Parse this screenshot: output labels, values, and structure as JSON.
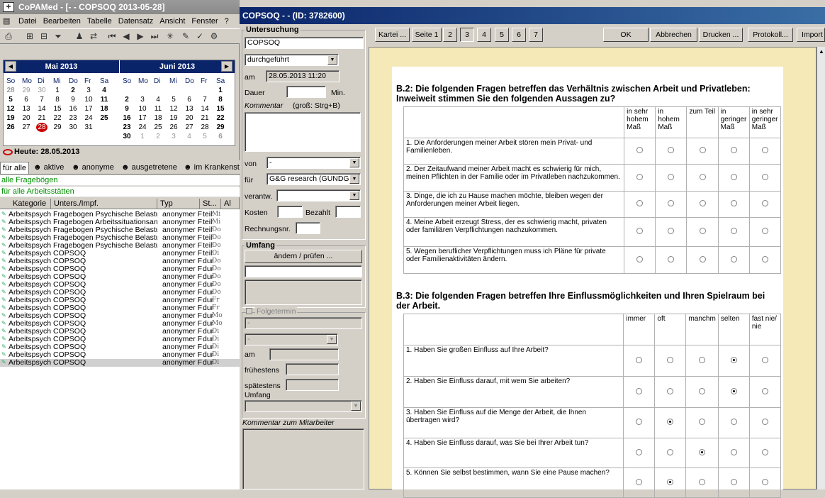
{
  "main_window": {
    "title": "CoPAMed - [- - COPSOQ 2013-05-28]",
    "menu": [
      "Datei",
      "Bearbeiten",
      "Tabelle",
      "Datensatz",
      "Ansicht",
      "Fenster",
      "?"
    ]
  },
  "calendar": {
    "may": {
      "label": "Mai 2013",
      "weekdays": [
        "So",
        "Mo",
        "Di",
        "Mi",
        "Do",
        "Fr",
        "Sa"
      ],
      "rows": [
        [
          "28",
          "29",
          "30",
          "1",
          "2",
          "3",
          "4"
        ],
        [
          "5",
          "6",
          "7",
          "8",
          "9",
          "10",
          "11"
        ],
        [
          "12",
          "13",
          "14",
          "15",
          "16",
          "17",
          "18"
        ],
        [
          "19",
          "20",
          "21",
          "22",
          "23",
          "24",
          "25"
        ],
        [
          "26",
          "27",
          "28",
          "29",
          "30",
          "31",
          ""
        ]
      ]
    },
    "june": {
      "label": "Juni 2013",
      "weekdays": [
        "So",
        "Mo",
        "Di",
        "Mi",
        "Do",
        "Fr",
        "Sa"
      ],
      "rows": [
        [
          "",
          "",
          "",
          "",
          "",
          "",
          "1"
        ],
        [
          "2",
          "3",
          "4",
          "5",
          "6",
          "7",
          "8"
        ],
        [
          "9",
          "10",
          "11",
          "12",
          "13",
          "14",
          "15"
        ],
        [
          "16",
          "17",
          "18",
          "19",
          "20",
          "21",
          "22"
        ],
        [
          "23",
          "24",
          "25",
          "26",
          "27",
          "28",
          "29"
        ],
        [
          "30",
          "1",
          "2",
          "3",
          "4",
          "5",
          "6"
        ]
      ]
    },
    "today_label": "Heute: 28.05.2013"
  },
  "filter_tabs": [
    "für alle",
    "aktive",
    "anonyme",
    "ausgetretene",
    "im Krankenstand"
  ],
  "filter_lines": [
    "alle Fragebögen",
    "für alle Arbeitsstätten"
  ],
  "list": {
    "headers": [
      "Kategorie",
      "Unters./Impf.",
      "Typ",
      "St...",
      "Al"
    ],
    "rows": [
      [
        "Arbeitspsych Fragebogen Psychische Belastung",
        "anonymer FB",
        "teilw.",
        "Mi"
      ],
      [
        "Arbeitspsych Fragebogen Arbeitssituationsanalyse",
        "anonymer FB",
        "teilw.",
        "Mi"
      ],
      [
        "Arbeitspsych Fragebogen Psychische Belastung",
        "anonymer FB",
        "teilw.",
        "Do"
      ],
      [
        "Arbeitspsych Fragebogen Psychische Belastung",
        "anonymer FB",
        "teilw.",
        "Do"
      ],
      [
        "Arbeitspsych Fragebogen Psychische Belastung",
        "anonymer FB",
        "teilw.",
        "Do"
      ],
      [
        "Arbeitspsych COPSOQ",
        "anonymer FB",
        "teilw.",
        "Di"
      ],
      [
        "Arbeitspsych COPSOQ",
        "anonymer FB",
        "durch",
        "Do"
      ],
      [
        "Arbeitspsych COPSOQ",
        "anonymer FB",
        "durch",
        "Do"
      ],
      [
        "Arbeitspsych COPSOQ",
        "anonymer FB",
        "durch",
        "Do"
      ],
      [
        "Arbeitspsych COPSOQ",
        "anonymer FB",
        "durch",
        "Do"
      ],
      [
        "Arbeitspsych COPSOQ",
        "anonymer FB",
        "durch",
        "Do"
      ],
      [
        "Arbeitspsych COPSOQ",
        "anonymer FB",
        "durch",
        "Fr"
      ],
      [
        "Arbeitspsych COPSOQ",
        "anonymer FB",
        "durch",
        "Fr"
      ],
      [
        "Arbeitspsych COPSOQ",
        "anonymer FB",
        "durch",
        "Mo"
      ],
      [
        "Arbeitspsych COPSOQ",
        "anonymer FB",
        "durch",
        "Mo"
      ],
      [
        "Arbeitspsych COPSOQ",
        "anonymer FB",
        "durch",
        "Di"
      ],
      [
        "Arbeitspsych COPSOQ",
        "anonymer FB",
        "durch",
        "Di"
      ],
      [
        "Arbeitspsych COPSOQ",
        "anonymer FB",
        "durch",
        "Di"
      ],
      [
        "Arbeitspsych COPSOQ",
        "anonymer FB",
        "durch",
        "Di"
      ],
      [
        "Arbeitspsych COPSOQ",
        "anonymer FB",
        "durch",
        "Di"
      ]
    ]
  },
  "dialog": {
    "title": "COPSOQ -  - (ID: 3782600)",
    "untersuchung": {
      "group_label": "Untersuchung",
      "name": "COPSOQ",
      "status": "durchgeführt",
      "am_label": "am",
      "am_value": "28.05.2013 11:20",
      "dauer_label": "Dauer",
      "dauer_unit": "Min.",
      "kommentar_label": "Kommentar",
      "kommentar_hint": "(groß: Strg+B)",
      "von_label": "von",
      "von_value": "-",
      "fuer_label": "für",
      "fuer_value": "G&G research (GUNDG",
      "verantw_label": "verantw.",
      "kosten_label": "Kosten",
      "bezahlt_label": "Bezahlt",
      "rechnungsnr_label": "Rechnungsnr."
    },
    "umfang": {
      "group_label": "Umfang",
      "button": "ändern / prüfen ..."
    },
    "folgetermin": {
      "checkbox_label": "Folgetermin",
      "field": "-",
      "select": "-",
      "am_label": "am",
      "fruehestens_label": "frühestens",
      "spaetestens_label": "spätestens",
      "umfang_label": "Umfang"
    },
    "kommentar_mitarbeiter_label": "Kommentar zum Mitarbeiter",
    "page_tabs": [
      "Kartei ...",
      "Seite 1",
      "2",
      "3",
      "4",
      "5",
      "6",
      "7"
    ],
    "active_page": "3",
    "action_buttons": [
      "OK",
      "Abbrechen",
      "Drucken ...",
      "Protokoll...",
      "Import"
    ]
  },
  "questionnaire": {
    "b2": {
      "title": "B.2: Die folgenden Fragen betreffen das Verhältnis zwischen Arbeit und Privatleben: Inweiweit stimmen Sie den folgenden Aussagen zu?",
      "columns": [
        "in sehr hohem Maß",
        "in hohem Maß",
        "zum Teil",
        "in geringer Maß",
        "in sehr geringer Maß"
      ],
      "questions": [
        {
          "text": "1. Die Anforderungen meiner Arbeit stören mein Privat- und Familienleben.",
          "selected": -1
        },
        {
          "text": "2. Der Zeitaufwand meiner Arbeit macht es schwierig für mich, meinen Pflichten in der Familie oder im Privatleben nachzukommen.",
          "selected": -1
        },
        {
          "text": "3. Dinge, die ich zu Hause machen möchte, bleiben wegen der Anforderungen meiner Arbeit liegen.",
          "selected": -1
        },
        {
          "text": "4. Meine Arbeit erzeugt Stress, der es schwierig macht, privaten oder familiären Verpflichtungen nachzukommen.",
          "selected": -1
        },
        {
          "text": "5. Wegen beruflicher Verpflichtungen muss ich Pläne für private oder Familienaktivitäten ändern.",
          "selected": -1
        }
      ]
    },
    "b3": {
      "title": "B.3: Die folgenden Fragen betreffen Ihre Einflussmöglichkeiten und Ihren Spielraum bei der Arbeit.",
      "columns": [
        "immer",
        "oft",
        "manchm",
        "selten",
        "fast nie/ nie"
      ],
      "questions": [
        {
          "text": "1. Haben Sie großen Einfluss auf Ihre Arbeit?",
          "selected": 3
        },
        {
          "text": "2. Haben Sie Einfluss darauf, mit wem Sie arbeiten?",
          "selected": 3
        },
        {
          "text": "3. Haben Sie Einfluss auf die Menge der Arbeit, die Ihnen übertragen wird?",
          "selected": 1
        },
        {
          "text": "4. Haben Sie Einfluss darauf, was Sie bei Ihrer Arbeit tun?",
          "selected": 2
        },
        {
          "text": "5. Können Sie selbst bestimmen, wann Sie eine Pause machen?",
          "selected": 1
        }
      ]
    }
  }
}
